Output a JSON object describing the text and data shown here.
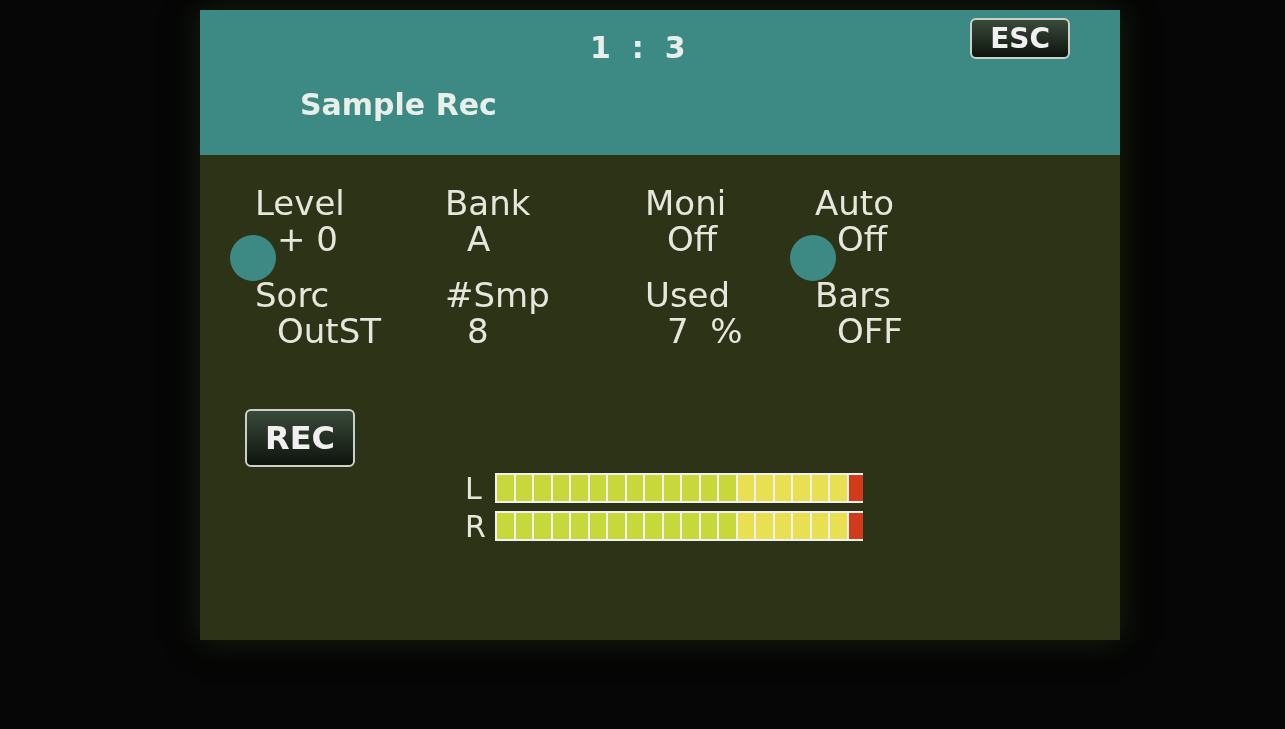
{
  "header": {
    "position": "1  :  3",
    "title": "Sample Rec",
    "esc": "ESC"
  },
  "params": [
    {
      "label": "Level",
      "value": "+ 0",
      "knob": true
    },
    {
      "label": "Bank",
      "value": "A",
      "knob": false
    },
    {
      "label": "Moni",
      "value": "Off",
      "knob": false
    },
    {
      "label": "Auto",
      "value": "Off",
      "knob": true
    },
    {
      "label": "Sorc",
      "value": "OutST",
      "knob": false
    },
    {
      "label": "#Smp",
      "value": "8",
      "knob": false
    },
    {
      "label": "Used",
      "value": "7  %",
      "knob": false
    },
    {
      "label": "Bars",
      "value": "OFF",
      "knob": false
    }
  ],
  "rec": "REC",
  "meters": [
    {
      "label": "L",
      "level": 1
    },
    {
      "label": "R",
      "level": 1
    }
  ]
}
